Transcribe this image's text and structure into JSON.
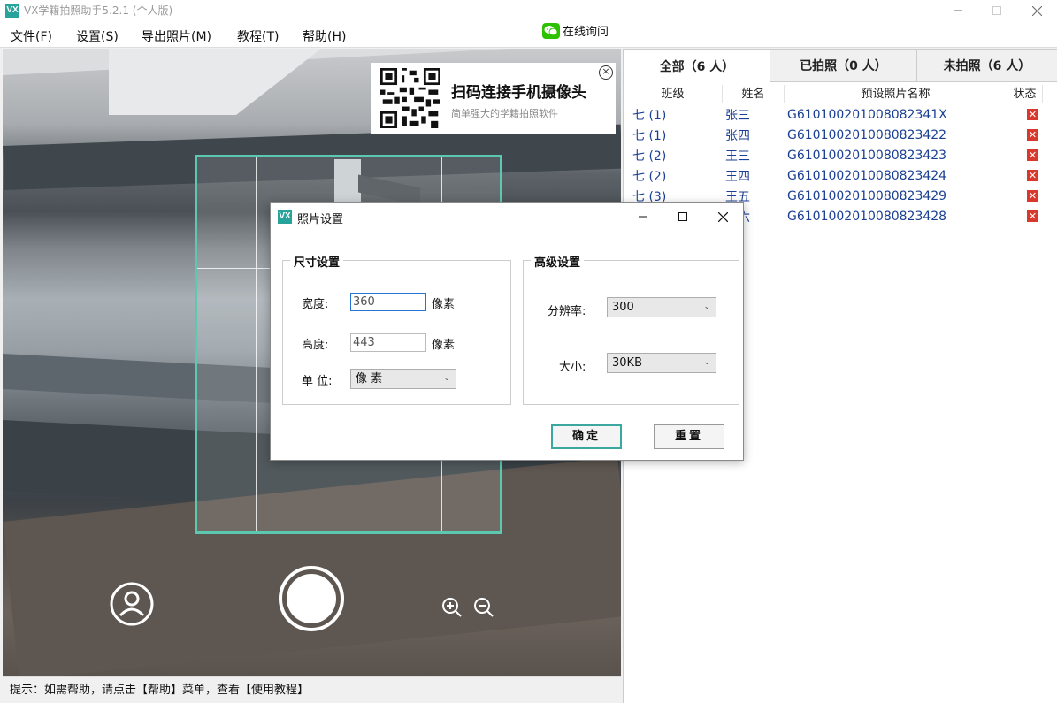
{
  "app": {
    "logo_text": "VX",
    "title": "VX学籍拍照助手5.2.1 (个人版)"
  },
  "menu": [
    "文件(F)",
    "设置(S)",
    "导出照片(M)",
    "教程(T)",
    "帮助(H)"
  ],
  "online_consult": "在线询问",
  "qr_banner": {
    "title": "扫码连接手机摄像头",
    "subtitle": "简单强大的学籍拍照软件",
    "close": "×"
  },
  "status_bar": "提示：如需帮助，请点击【帮助】菜单，查看【使用教程】",
  "tabs": [
    {
      "label": "全部（6 人）",
      "active": true
    },
    {
      "label": "已拍照（0 人）",
      "active": false
    },
    {
      "label": "未拍照（6 人）",
      "active": false
    }
  ],
  "table": {
    "headers": [
      "班级",
      "姓名",
      "预设照片名称",
      "状态"
    ],
    "rows": [
      {
        "class": "七 (1)",
        "name": "张三",
        "photo": "G610100201008082341X",
        "status": "✕"
      },
      {
        "class": "七 (1)",
        "name": "张四",
        "photo": "G6101002010080823422",
        "status": "✕"
      },
      {
        "class": "七 (2)",
        "name": "王三",
        "photo": "G6101002010080823423",
        "status": "✕"
      },
      {
        "class": "七 (2)",
        "name": "王四",
        "photo": "G6101002010080823424",
        "status": "✕"
      },
      {
        "class": "七 (3)",
        "name": "王五",
        "photo": "G6101002010080823429",
        "status": "✕"
      },
      {
        "class": "七 (3)",
        "name": "王六",
        "photo": "G6101002010080823428",
        "status": "✕"
      }
    ]
  },
  "dialog": {
    "logo_text": "VX",
    "title": "照片设置",
    "size_group": {
      "title": "尺寸设置",
      "width_label": "宽度:",
      "width_value": "360",
      "height_label": "高度:",
      "height_value": "443",
      "px_unit": "像素",
      "unit_label": "单 位:",
      "unit_value": "像 素"
    },
    "advanced_group": {
      "title": "高级设置",
      "resolution_label": "分辨率:",
      "resolution_value": "300",
      "size_label": "大小:",
      "size_value": "30KB"
    },
    "ok_label": "确定",
    "reset_label": "重置"
  },
  "colors": {
    "accent": "#27a39b",
    "link_text": "#1a3f93",
    "status_x": "#d9392d",
    "crop_frame": "#5cc8b0"
  }
}
